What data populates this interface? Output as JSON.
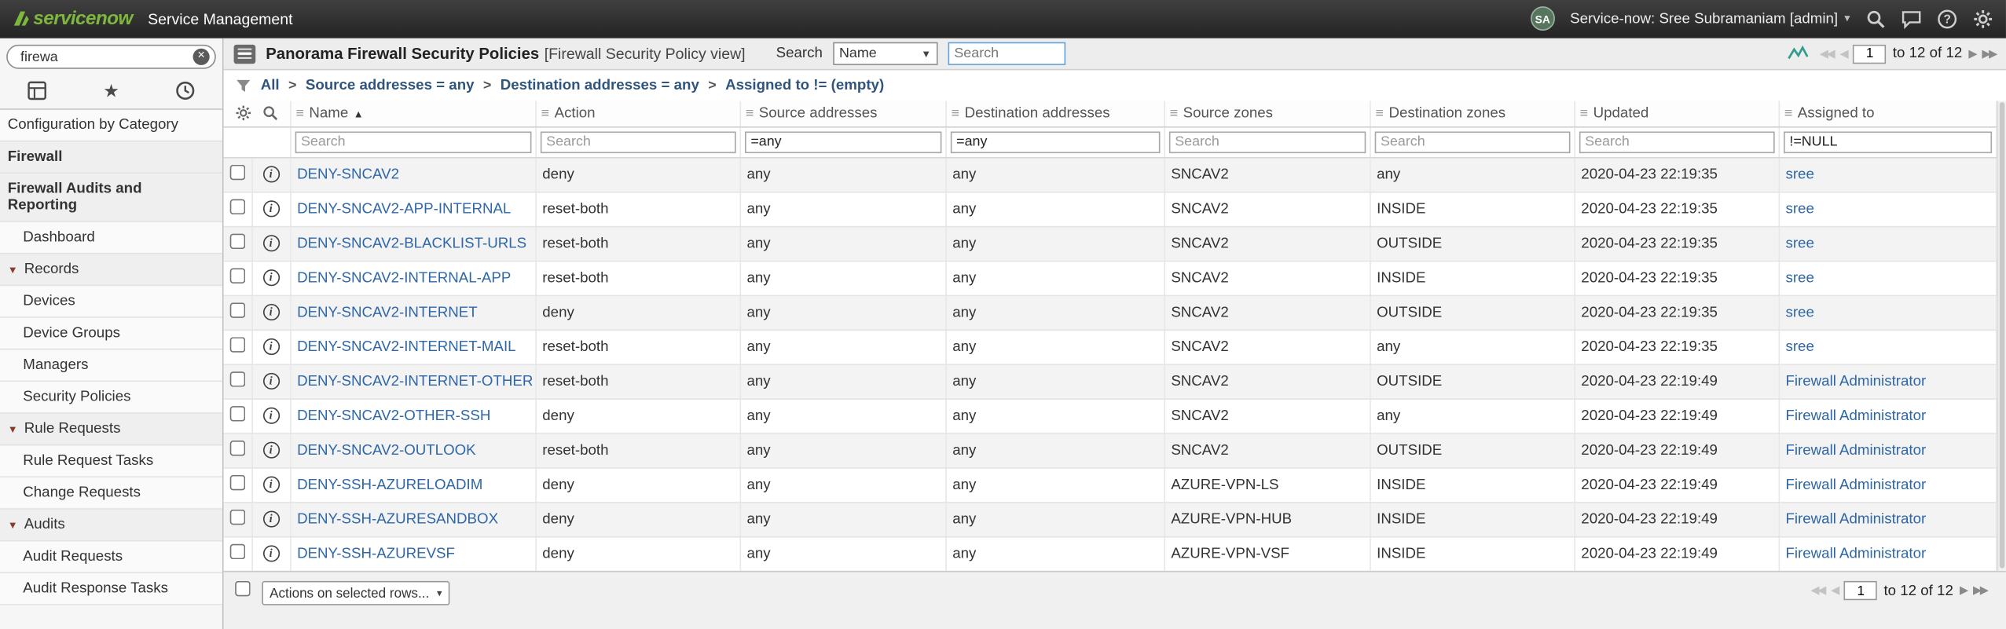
{
  "header": {
    "logo": "servicenow",
    "product": "Service Management",
    "user": {
      "initials": "SA",
      "label": "Service-now: Sree Subramaniam [admin]"
    }
  },
  "sidebar": {
    "search_value": "firewa",
    "items": [
      {
        "label": "Configuration by Category",
        "type": "module",
        "indent": 0
      },
      {
        "label": "Firewall",
        "type": "app",
        "indent": 0
      },
      {
        "label": "Firewall Audits and Reporting",
        "type": "app",
        "indent": 0
      },
      {
        "label": "Dashboard",
        "type": "module",
        "indent": 1
      },
      {
        "label": "Records",
        "type": "section",
        "indent": 0
      },
      {
        "label": "Devices",
        "type": "module",
        "indent": 1
      },
      {
        "label": "Device Groups",
        "type": "module",
        "indent": 1
      },
      {
        "label": "Managers",
        "type": "module",
        "indent": 1
      },
      {
        "label": "Security Policies",
        "type": "module",
        "indent": 1
      },
      {
        "label": "Rule Requests",
        "type": "section",
        "indent": 0
      },
      {
        "label": "Rule Request Tasks",
        "type": "module",
        "indent": 1
      },
      {
        "label": "Change Requests",
        "type": "module",
        "indent": 1
      },
      {
        "label": "Audits",
        "type": "section",
        "indent": 0
      },
      {
        "label": "Audit Requests",
        "type": "module",
        "indent": 1
      },
      {
        "label": "Audit Response Tasks",
        "type": "module",
        "indent": 1
      }
    ]
  },
  "list": {
    "title": "Panorama Firewall Security Policies",
    "view_label": "[Firewall Security Policy view]",
    "search": {
      "label": "Search",
      "field": "Name",
      "placeholder": "Search"
    },
    "breadcrumb": {
      "crumbs": [
        "All",
        "Source addresses = any",
        "Destination addresses = any",
        "Assigned to != (empty)"
      ]
    },
    "pagination": {
      "page": "1",
      "range": "to 12 of 12"
    },
    "columns": [
      {
        "label": "Name",
        "filter": "Search",
        "filter_is_value": false,
        "sorted": "asc"
      },
      {
        "label": "Action",
        "filter": "Search",
        "filter_is_value": false
      },
      {
        "label": "Source addresses",
        "filter": "=any",
        "filter_is_value": true
      },
      {
        "label": "Destination addresses",
        "filter": "=any",
        "filter_is_value": true
      },
      {
        "label": "Source zones",
        "filter": "Search",
        "filter_is_value": false
      },
      {
        "label": "Destination zones",
        "filter": "Search",
        "filter_is_value": false
      },
      {
        "label": "Updated",
        "filter": "Search",
        "filter_is_value": false
      },
      {
        "label": "Assigned to",
        "filter": "!=NULL",
        "filter_is_value": true
      }
    ],
    "rows": [
      {
        "name": "DENY-SNCAV2",
        "action": "deny",
        "source_addresses": "any",
        "destination_addresses": "any",
        "source_zones": "SNCAV2",
        "destination_zones": "any",
        "updated": "2020-04-23 22:19:35",
        "assigned_to": "sree"
      },
      {
        "name": "DENY-SNCAV2-APP-INTERNAL",
        "action": "reset-both",
        "source_addresses": "any",
        "destination_addresses": "any",
        "source_zones": "SNCAV2",
        "destination_zones": "INSIDE",
        "updated": "2020-04-23 22:19:35",
        "assigned_to": "sree"
      },
      {
        "name": "DENY-SNCAV2-BLACKLIST-URLS",
        "action": "reset-both",
        "source_addresses": "any",
        "destination_addresses": "any",
        "source_zones": "SNCAV2",
        "destination_zones": "OUTSIDE",
        "updated": "2020-04-23 22:19:35",
        "assigned_to": "sree"
      },
      {
        "name": "DENY-SNCAV2-INTERNAL-APP",
        "action": "reset-both",
        "source_addresses": "any",
        "destination_addresses": "any",
        "source_zones": "SNCAV2",
        "destination_zones": "INSIDE",
        "updated": "2020-04-23 22:19:35",
        "assigned_to": "sree"
      },
      {
        "name": "DENY-SNCAV2-INTERNET",
        "action": "deny",
        "source_addresses": "any",
        "destination_addresses": "any",
        "source_zones": "SNCAV2",
        "destination_zones": "OUTSIDE",
        "updated": "2020-04-23 22:19:35",
        "assigned_to": "sree"
      },
      {
        "name": "DENY-SNCAV2-INTERNET-MAIL",
        "action": "reset-both",
        "source_addresses": "any",
        "destination_addresses": "any",
        "source_zones": "SNCAV2",
        "destination_zones": "any",
        "updated": "2020-04-23 22:19:35",
        "assigned_to": "sree"
      },
      {
        "name": "DENY-SNCAV2-INTERNET-OTHER",
        "action": "reset-both",
        "source_addresses": "any",
        "destination_addresses": "any",
        "source_zones": "SNCAV2",
        "destination_zones": "OUTSIDE",
        "updated": "2020-04-23 22:19:49",
        "assigned_to": "Firewall Administrator"
      },
      {
        "name": "DENY-SNCAV2-OTHER-SSH",
        "action": "deny",
        "source_addresses": "any",
        "destination_addresses": "any",
        "source_zones": "SNCAV2",
        "destination_zones": "any",
        "updated": "2020-04-23 22:19:49",
        "assigned_to": "Firewall Administrator"
      },
      {
        "name": "DENY-SNCAV2-OUTLOOK",
        "action": "reset-both",
        "source_addresses": "any",
        "destination_addresses": "any",
        "source_zones": "SNCAV2",
        "destination_zones": "OUTSIDE",
        "updated": "2020-04-23 22:19:49",
        "assigned_to": "Firewall Administrator"
      },
      {
        "name": "DENY-SSH-AZURELOADIM",
        "action": "deny",
        "source_addresses": "any",
        "destination_addresses": "any",
        "source_zones": "AZURE-VPN-LS",
        "destination_zones": "INSIDE",
        "updated": "2020-04-23 22:19:49",
        "assigned_to": "Firewall Administrator"
      },
      {
        "name": "DENY-SSH-AZURESANDBOX",
        "action": "deny",
        "source_addresses": "any",
        "destination_addresses": "any",
        "source_zones": "AZURE-VPN-HUB",
        "destination_zones": "INSIDE",
        "updated": "2020-04-23 22:19:49",
        "assigned_to": "Firewall Administrator"
      },
      {
        "name": "DENY-SSH-AZUREVSF",
        "action": "deny",
        "source_addresses": "any",
        "destination_addresses": "any",
        "source_zones": "AZURE-VPN-VSF",
        "destination_zones": "INSIDE",
        "updated": "2020-04-23 22:19:49",
        "assigned_to": "Firewall Administrator"
      }
    ],
    "footer": {
      "actions_label": "Actions on selected rows..."
    }
  },
  "icons": {
    "column_menu": "≡",
    "sort_asc": "▲",
    "section_arrow": "▼",
    "first": "◀◀",
    "prev": "◀",
    "next": "▶",
    "last": "▶▶",
    "caret_down": "▾",
    "select_caret": "▼",
    "crumb_sep": ">",
    "favorites_star": "★",
    "clear": "×",
    "info": "i"
  }
}
